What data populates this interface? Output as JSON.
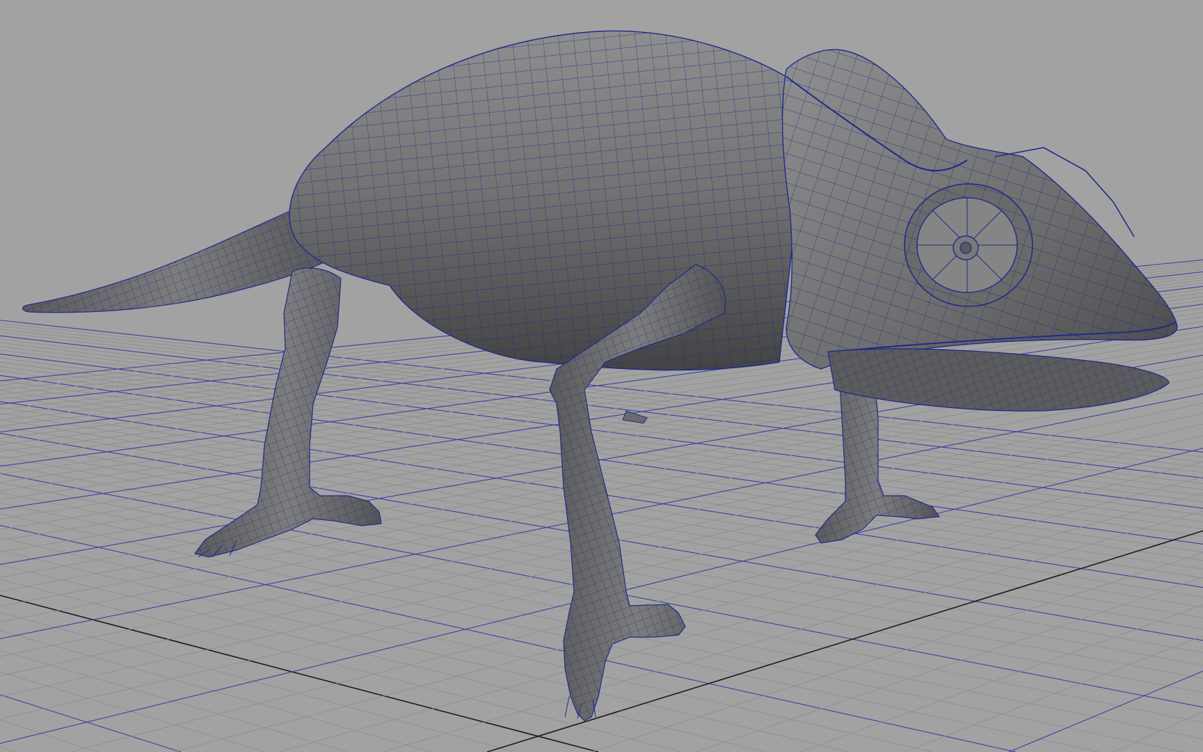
{
  "viewport": {
    "panel": "perspective",
    "display_mode": "wireframe-on-shaded",
    "grid_visible": true,
    "subject": "chameleon-polygon-mesh"
  },
  "colors": {
    "background": "#a2a2a2",
    "grid_line": "#8e8e8e",
    "grid_axis": "#1a1a1a",
    "grid_major": "#3b3fa0",
    "mesh_shade_light": "#8c8c8c",
    "mesh_shade_mid": "#6e6e6e",
    "mesh_shade_dark": "#3e3e3e",
    "wireframe": "#1f2a8a"
  }
}
